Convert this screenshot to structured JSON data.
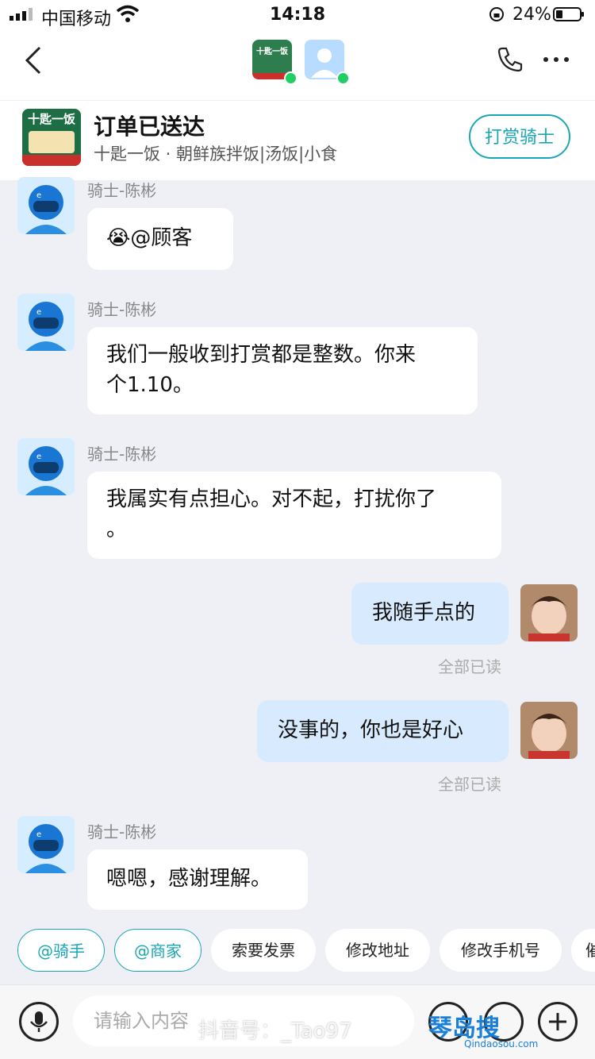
{
  "status": {
    "carrier": "中国移动",
    "time": "14:18",
    "battery": "24%"
  },
  "header": {
    "avatar_shop": "shop-avatar",
    "avatar_user": "user-avatar"
  },
  "order": {
    "title": "订单已送达",
    "shop": "十匙一饭 · 朝鲜族拌饭|汤饭|小食",
    "logo_text": "十匙一饭",
    "tip_button": "打赏骑士"
  },
  "messages": [
    {
      "sender": "骑士-陈彬",
      "text": "@顾客",
      "emoji": "😭"
    },
    {
      "sender": "骑士-陈彬",
      "line1": "我们一般收到打赏都是整数。你来",
      "line2": "个1.10。"
    },
    {
      "sender": "骑士-陈彬",
      "line1": "我属实有点担心。对不起，打扰你了",
      "line2": "。"
    },
    {
      "sender": "me",
      "text": "我随手点的",
      "read": "全部已读"
    },
    {
      "sender": "me",
      "text": "没事的，你也是好心",
      "read": "全部已读"
    },
    {
      "sender": "骑士-陈彬",
      "text": "嗯嗯，感谢理解。"
    }
  ],
  "quick": [
    "@骑手",
    "@商家",
    "索要发票",
    "修改地址",
    "修改手机号",
    "催"
  ],
  "input": {
    "placeholder": "请输入内容"
  },
  "watermark": {
    "douyin": "抖音号：_Tao97",
    "site": "琴岛搜",
    "url": "Qindaosou.com"
  },
  "colors": {
    "accent": "#1aa7b5",
    "online": "#1fcf64",
    "mine_bubble": "#d8eafd"
  }
}
